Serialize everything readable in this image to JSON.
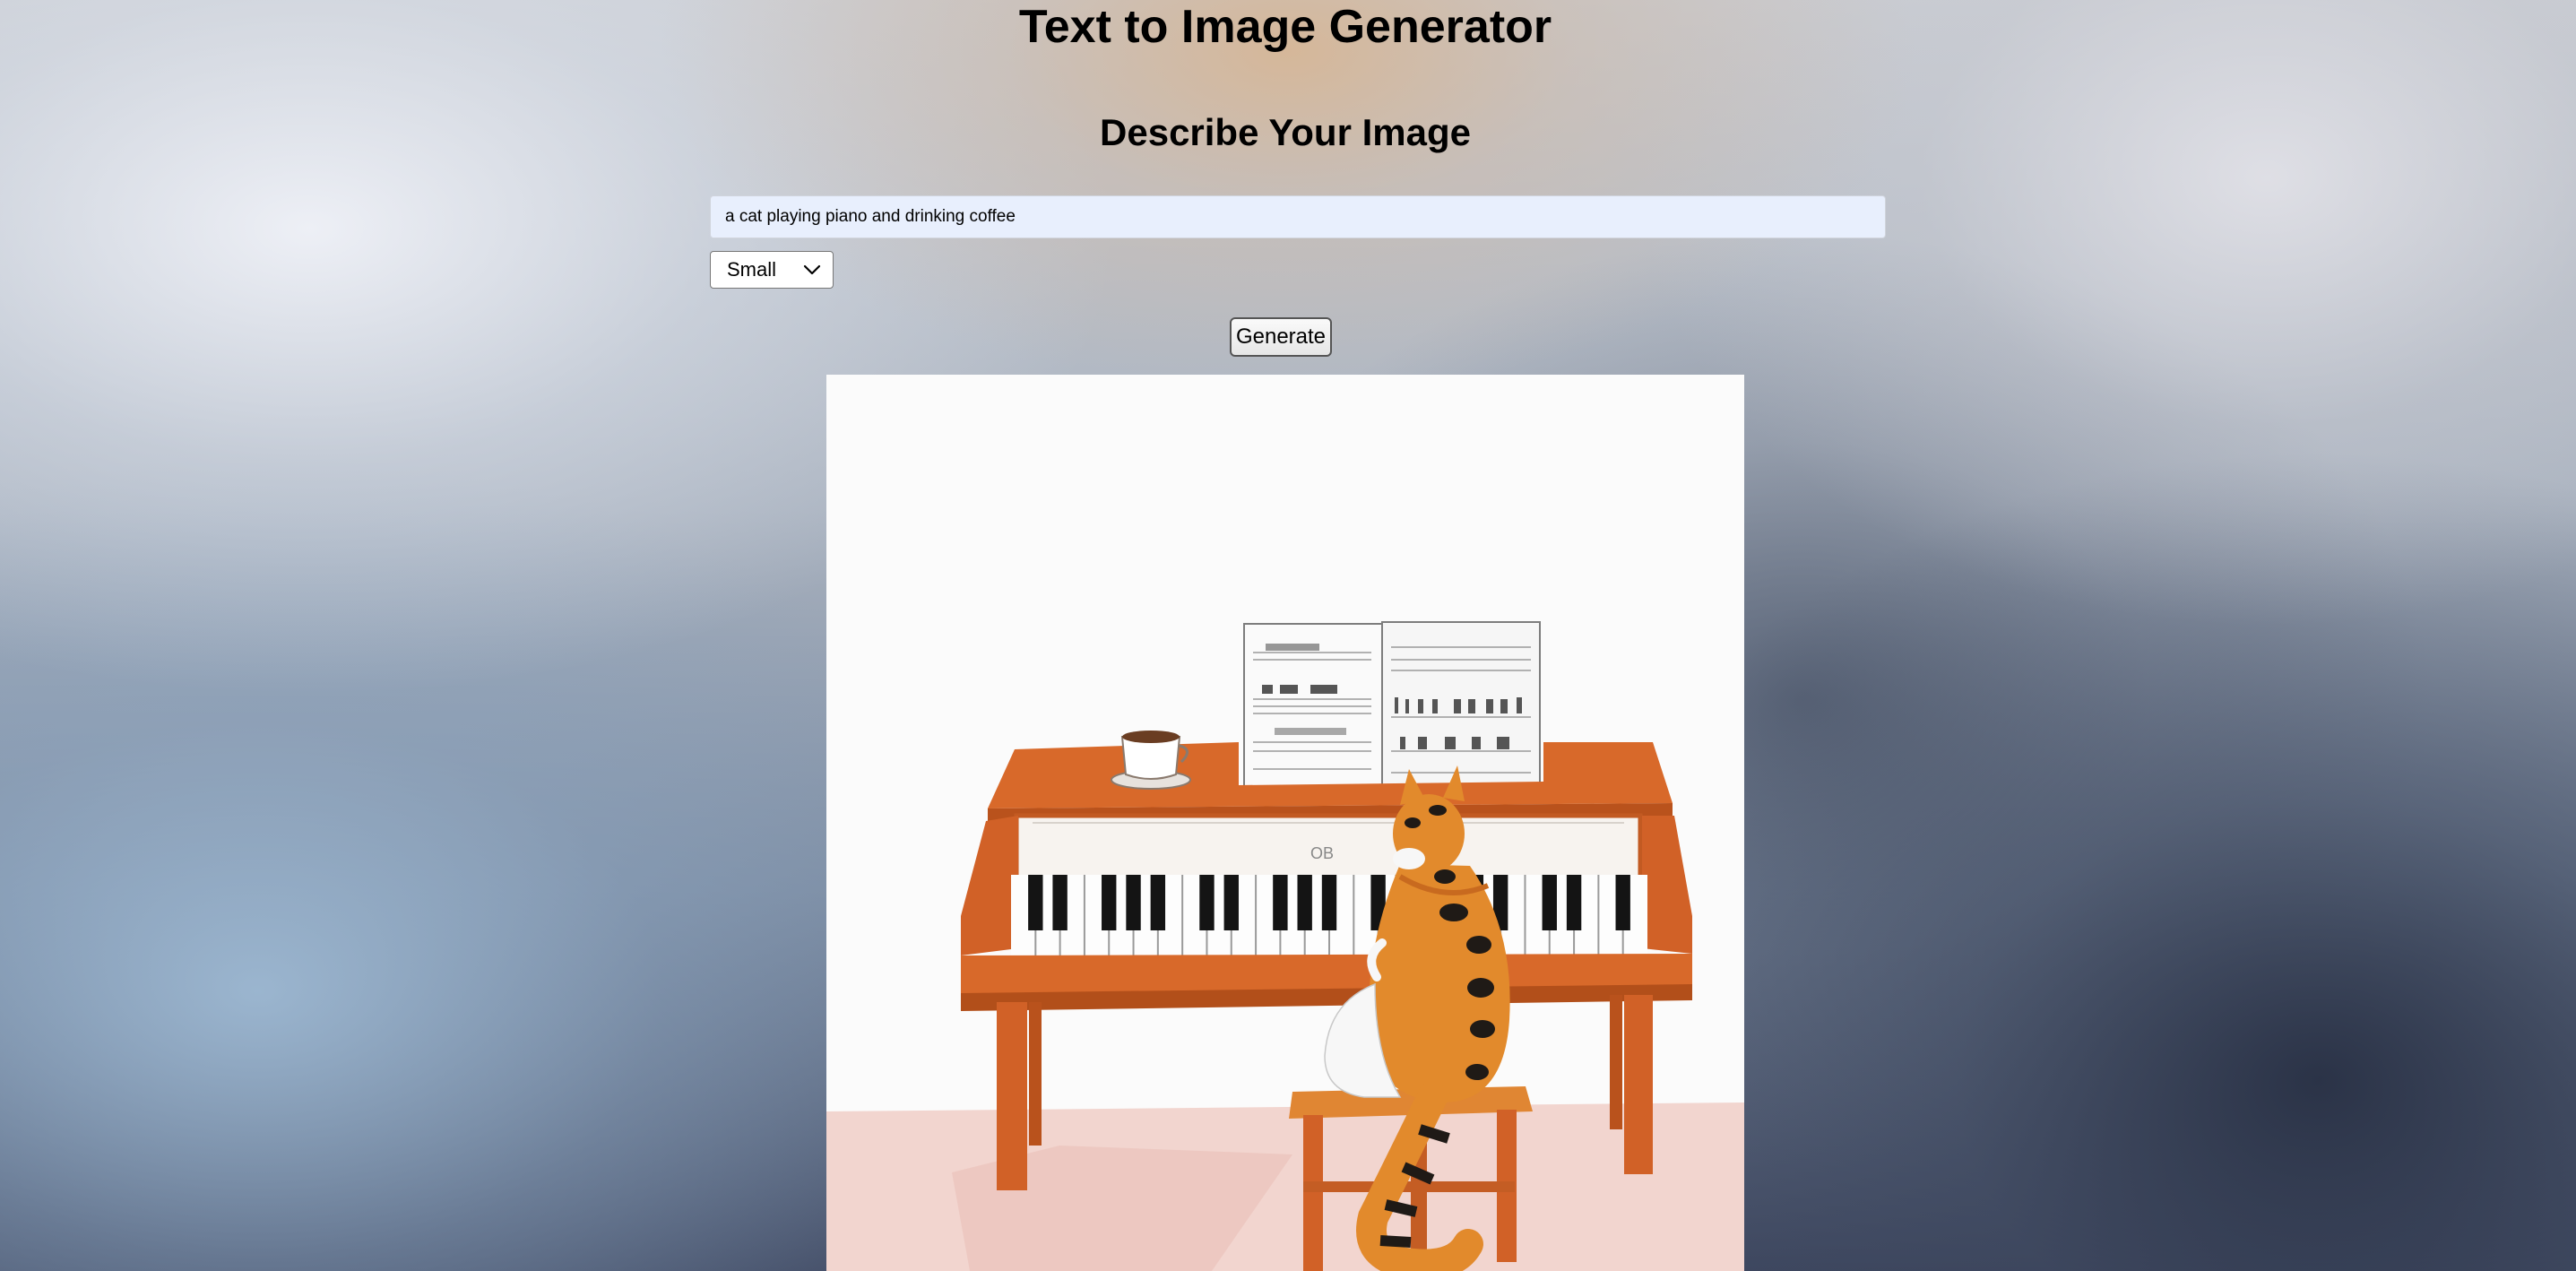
{
  "app": {
    "title": "Text to Image Generator"
  },
  "form": {
    "section_title": "Describe Your Image",
    "prompt_value": "a cat playing piano and drinking coffee",
    "size_select": {
      "selected": "Small",
      "icon": "chevron-down-icon"
    },
    "generate_label": "Generate"
  },
  "result": {
    "image_subject": "cat playing piano with coffee cup"
  },
  "colors": {
    "input_background": "#e8effd",
    "piano_wood": "#d8692a",
    "cat_orange": "#e28a2c",
    "floor": "#f1d2cc"
  }
}
